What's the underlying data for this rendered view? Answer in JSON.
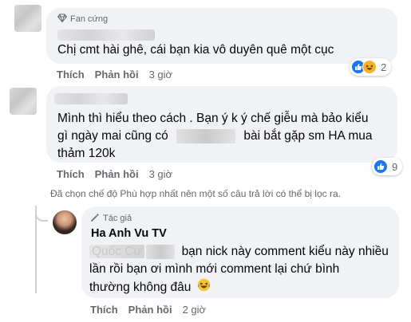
{
  "comment1": {
    "badge": "Fan cứng",
    "text": "Chị cmt hài ghê, cái bạn kia vô duyên quê một cục",
    "actions": {
      "like": "Thích",
      "reply": "Phản hồi",
      "time": "3 giờ"
    },
    "reaction_count": "2"
  },
  "comment2": {
    "line1": "Mình thì hiểu theo cách . Bạn ý k ý chế giễu mà bảo kiểu",
    "line2_a": "gì ngày mai cũng có",
    "line2_b": "bài bắt gặp sm HA mua",
    "line3": "thảm 120k",
    "actions": {
      "like": "Thích",
      "reply": "Phản hồi",
      "time": "3 giờ"
    },
    "reaction_count": "9"
  },
  "notice": "Đã chọn chế độ Phù hợp nhất nên một số câu trả lời có thể bị lọc ra.",
  "reply": {
    "badge": "Tác giả",
    "author": "Ha Anh Vu TV",
    "line1_a": "Quốc Cư",
    "line1_b": "bạn nick này comment kiểu này nhiều",
    "line2": "lần rồi bạn ơi mình mới comment lại chứ bình",
    "line3": "thường không đâu",
    "actions": {
      "like": "Thích",
      "reply": "Phản hồi",
      "time": "2 giờ"
    }
  },
  "colors": {
    "bubble": "#f0f2f5",
    "meta": "#65676b",
    "like_blue": "#1877f2",
    "haha_yellow": "#f7b125"
  },
  "icons": [
    "diamond-icon",
    "like-reaction-icon",
    "haha-reaction-icon",
    "laughing-emoji-icon",
    "wand-icon"
  ]
}
